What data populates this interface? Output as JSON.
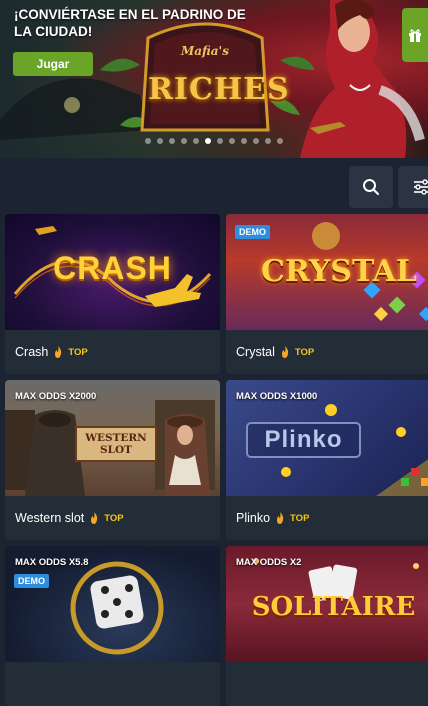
{
  "banner": {
    "title": "¡CONVIÉRTASE EN EL PADRINO DE LA CIUDAD!",
    "play_label": "Jugar",
    "logo_top": "Mafia's",
    "logo_main": "RICHES",
    "slides_total": 12,
    "slide_active": 5,
    "icons": {
      "gift": "gift-icon"
    }
  },
  "toolbar": {
    "icons": {
      "search": "search-icon",
      "filter": "filter-icon"
    }
  },
  "games": [
    {
      "name": "Crash",
      "top": "TOP",
      "thumb_text": "CRASH",
      "demo": "",
      "odds": ""
    },
    {
      "name": "Crystal",
      "top": "TOP",
      "thumb_text": "CRYSTAL",
      "demo": "DEMO",
      "odds": ""
    },
    {
      "name": "Western slot",
      "top": "TOP",
      "thumb_text": "WESTERN SLOT",
      "demo": "",
      "odds": "MAX ODDS X2000"
    },
    {
      "name": "Plinko",
      "top": "TOP",
      "thumb_text": "Plinko",
      "demo": "",
      "odds": "MAX ODDS X1000"
    },
    {
      "name": "",
      "top": "",
      "thumb_text": "",
      "demo": "DEMO",
      "odds": "MAX ODDS X5.8"
    },
    {
      "name": "",
      "top": "",
      "thumb_text": "SOLITAIRE",
      "demo": "",
      "odds": "MAX ODDS X2"
    }
  ],
  "colors": {
    "accent": "#6aa527",
    "top": "#f5c518",
    "demo": "#2d8ee0",
    "card": "#232d38",
    "bg": "#1b2430"
  }
}
